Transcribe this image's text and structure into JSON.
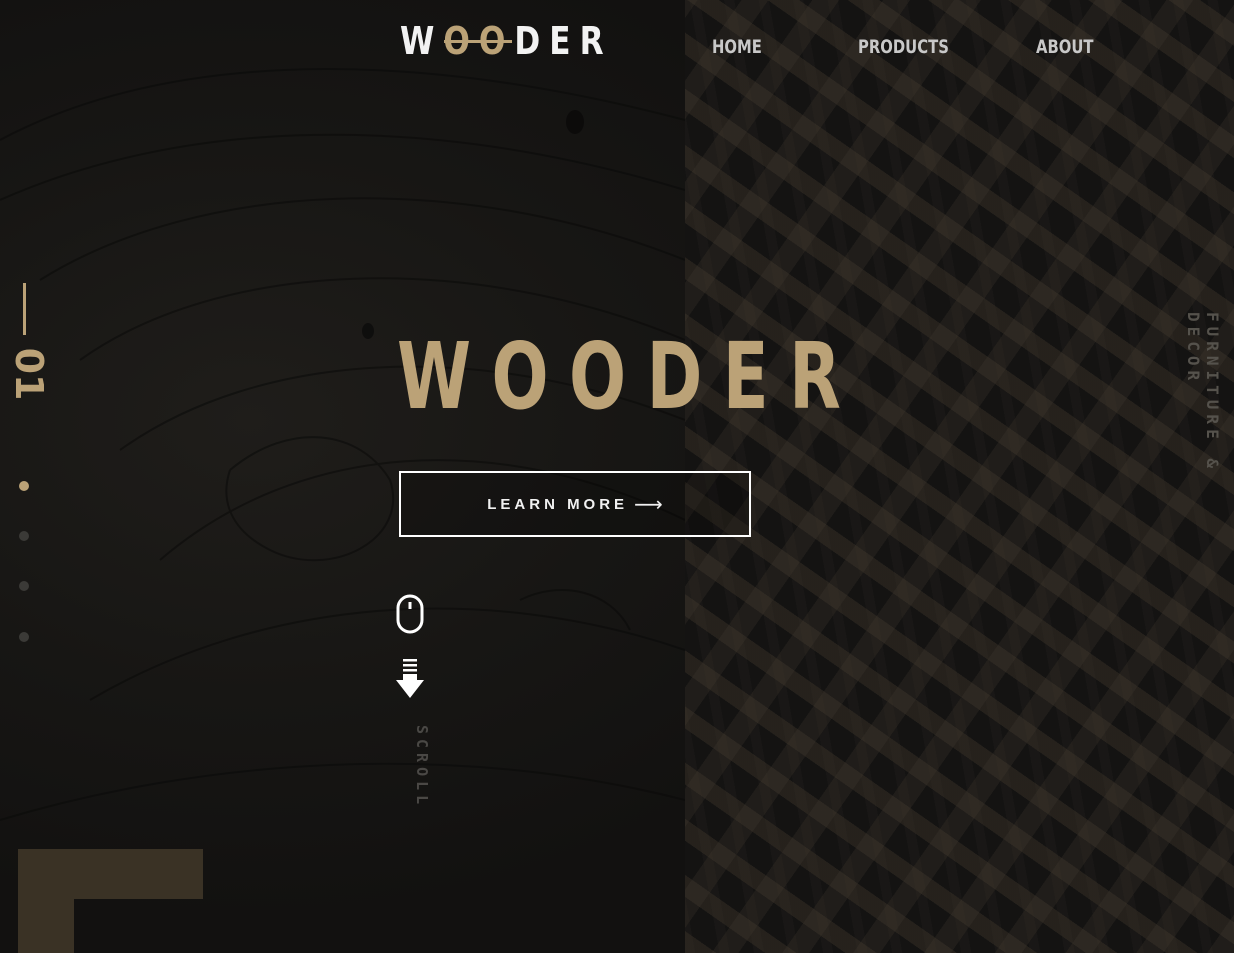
{
  "brand": {
    "logo_prefix": "W",
    "logo_gold": "OO",
    "logo_suffix": "DER",
    "accent_color": "#bba277"
  },
  "nav": {
    "items": [
      {
        "label": "HOME"
      },
      {
        "label": "PRODUCTS"
      },
      {
        "label": "ABOUT"
      }
    ]
  },
  "slider": {
    "current_index": "01",
    "active_slide": 1,
    "slide_count": 4
  },
  "hero": {
    "title": "WOODER",
    "cta_label": "LEARN MORE",
    "cta_arrow": "⟶"
  },
  "scroll_hint": {
    "label": "SCROLL",
    "icons": [
      "mouse-icon",
      "arrow-down-icon"
    ]
  },
  "side_caption": "FURNITURE & DECOR"
}
